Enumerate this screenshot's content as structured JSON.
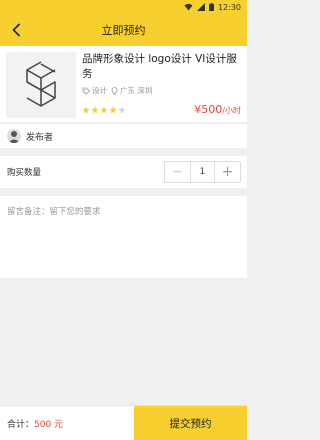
{
  "status": {
    "time": "12:30"
  },
  "header": {
    "title": "立即预约"
  },
  "product": {
    "title": "品牌形象设计 logo设计 VI设计服务",
    "category": "设计",
    "location": "广东 深圳",
    "rating": 4,
    "rating_max": 5,
    "price": "¥500",
    "price_unit": "/小时"
  },
  "publisher": {
    "label": "发布者"
  },
  "quantity": {
    "label": "购买数量",
    "value": "1",
    "minus": "—",
    "plus": "+"
  },
  "remark": {
    "placeholder": "留言备注：留下您的要求"
  },
  "footer": {
    "total_label": "合计：",
    "total_value": "500 元",
    "submit_label": "提交预约"
  },
  "colors": {
    "accent": "#f7cf2e",
    "price": "#e8483a"
  }
}
